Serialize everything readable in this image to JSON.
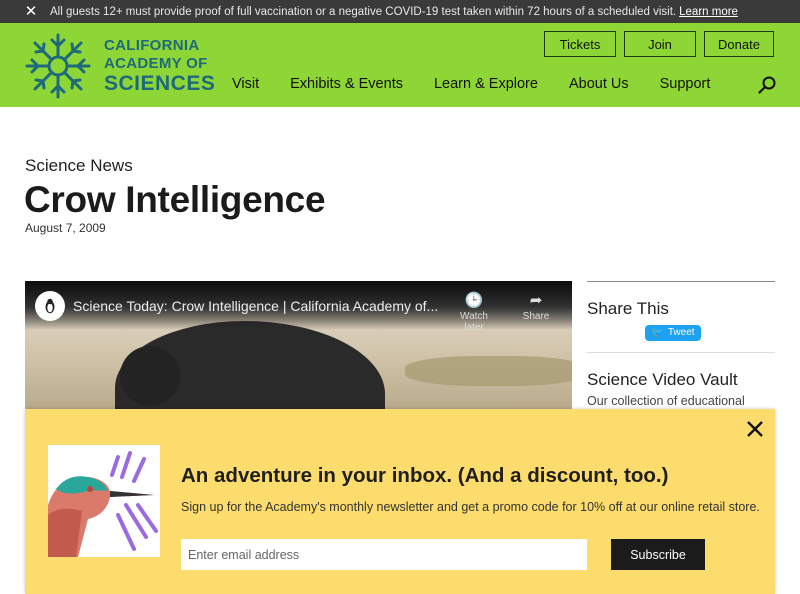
{
  "alert": {
    "message": "All guests 12+ must provide proof of full vaccination or a negative COVID-19 test taken within 72 hours of a scheduled visit.",
    "link": "Learn more"
  },
  "logo": {
    "line1": "CALIFORNIA",
    "line2": "ACADEMY OF",
    "line3": "SCIENCES"
  },
  "top_buttons": {
    "tickets": "Tickets",
    "join": "Join",
    "donate": "Donate"
  },
  "nav": {
    "items": [
      {
        "label": "Visit"
      },
      {
        "label": "Exhibits & Events"
      },
      {
        "label": "Learn & Explore"
      },
      {
        "label": "About Us"
      },
      {
        "label": "Support"
      }
    ]
  },
  "article": {
    "kicker": "Science News",
    "title": "Crow Intelligence",
    "date": "August 7, 2009"
  },
  "video": {
    "title": "Science Today: Crow Intelligence | California Academy of...",
    "watch_later": "Watch later",
    "share": "Share"
  },
  "sidebar": {
    "share_heading": "Share This",
    "tweet_label": "Tweet",
    "vault_heading": "Science Video Vault",
    "vault_text": "Our collection of educational videos"
  },
  "newsletter": {
    "headline": "An adventure in your inbox. (And a discount, too.)",
    "subtext": "Sign up for the Academy's monthly newsletter and get a promo code for 10% off at our online retail store.",
    "email_placeholder": "Enter email address",
    "subscribe": "Subscribe"
  },
  "colors": {
    "header_bg": "#8dd636",
    "logo_teal": "#1e6a7a",
    "alert_bg": "#3a3a3a",
    "newsletter_bg": "#fcdc6c",
    "tweet_blue": "#1da1f2"
  }
}
